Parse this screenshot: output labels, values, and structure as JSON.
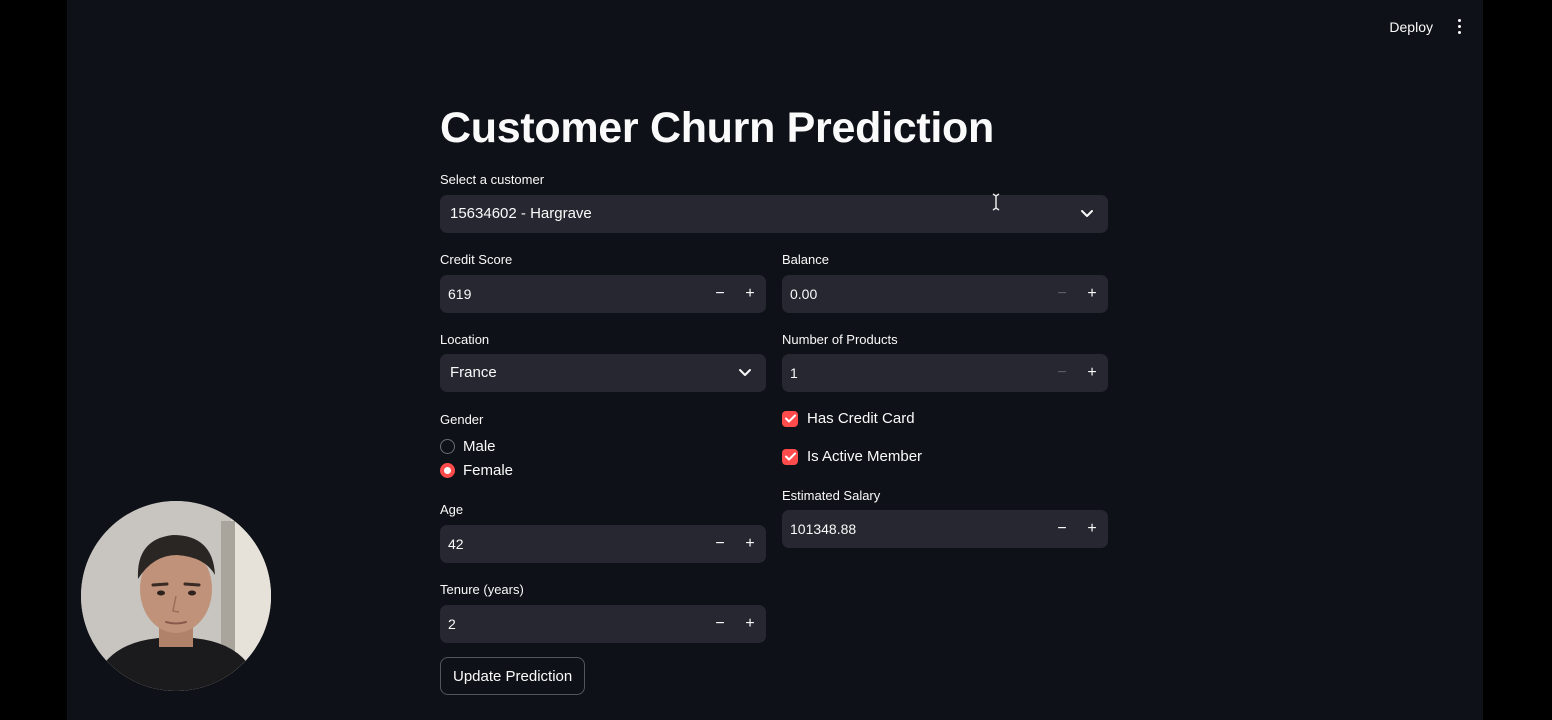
{
  "header": {
    "deploy_label": "Deploy",
    "menu_icon": "kebab-menu-icon"
  },
  "page": {
    "title": "Customer Churn Prediction"
  },
  "customer_select": {
    "label": "Select a customer",
    "value": "15634602 - Hargrave"
  },
  "credit_score": {
    "label": "Credit Score",
    "value": "619"
  },
  "balance": {
    "label": "Balance",
    "value": "0.00"
  },
  "location": {
    "label": "Location",
    "value": "France"
  },
  "num_products": {
    "label": "Number of Products",
    "value": "1"
  },
  "gender": {
    "label": "Gender",
    "options": [
      {
        "label": "Male",
        "checked": false
      },
      {
        "label": "Female",
        "checked": true
      }
    ]
  },
  "has_credit_card": {
    "label": "Has Credit Card",
    "checked": true
  },
  "is_active_member": {
    "label": "Is Active Member",
    "checked": true
  },
  "age": {
    "label": "Age",
    "value": "42"
  },
  "estimated_salary": {
    "label": "Estimated Salary",
    "value": "101348.88"
  },
  "tenure": {
    "label": "Tenure (years)",
    "value": "2"
  },
  "update_button": {
    "label": "Update Prediction"
  },
  "icons": {
    "minus": "−",
    "plus": "+"
  },
  "colors": {
    "accent": "#ff4b4b",
    "background": "#0e1117",
    "input_bg": "#262730",
    "text": "#fafafa"
  }
}
